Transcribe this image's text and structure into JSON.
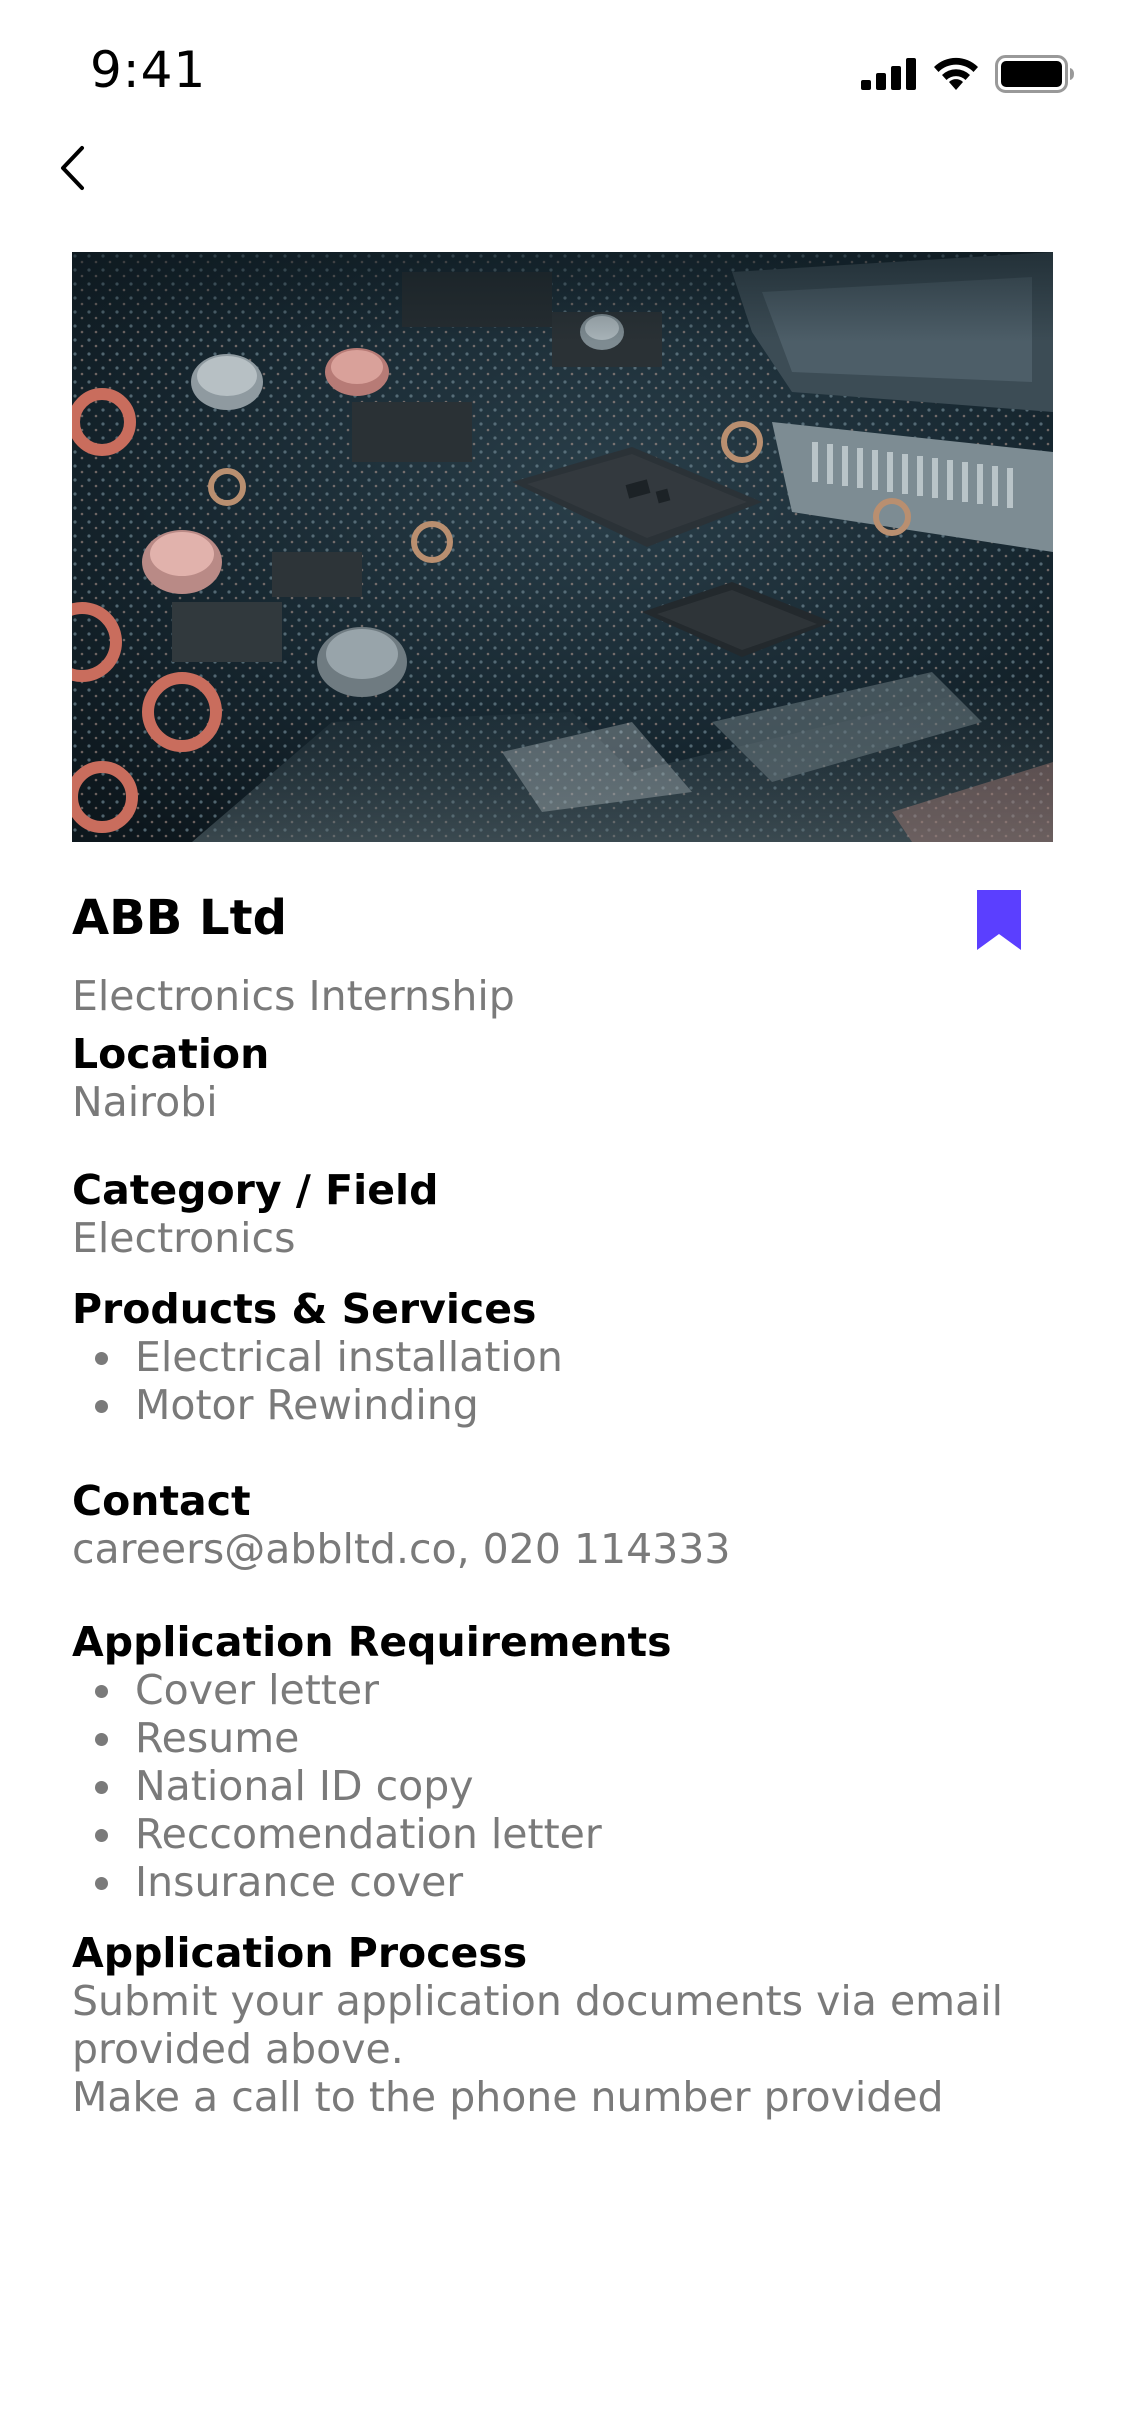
{
  "status_bar": {
    "time": "9:41",
    "icons": [
      "signal-icon",
      "wifi-icon",
      "battery-icon"
    ]
  },
  "nav": {
    "back_icon": "chevron-left-icon"
  },
  "hero_image": {
    "subject": "circuit-board-photo"
  },
  "company": {
    "name": "ABB Ltd",
    "role": "Electronics Internship",
    "bookmark_icon": "bookmark-icon",
    "bookmark_color": "#5B3FFF"
  },
  "sections": {
    "location": {
      "title": "Location",
      "value": "Nairobi"
    },
    "category": {
      "title": "Category / Field",
      "value": "Electronics"
    },
    "products": {
      "title": "Products & Services",
      "items": [
        "Electrical installation",
        "Motor Rewinding"
      ]
    },
    "contact": {
      "title": "Contact",
      "value": "careers@abbltd.co, 020 114333"
    },
    "requirements": {
      "title": "Application Requirements",
      "items": [
        "Cover letter",
        "Resume",
        "National ID copy",
        "Reccomendation letter",
        "Insurance cover"
      ]
    },
    "process": {
      "title": "Application Process",
      "lines": [
        "Submit your application documents via email",
        "provided above.",
        "Make a call to the phone number provided"
      ]
    }
  },
  "colors": {
    "text_primary": "#000000",
    "text_secondary": "#7A7A7A",
    "accent": "#5B3FFF"
  }
}
